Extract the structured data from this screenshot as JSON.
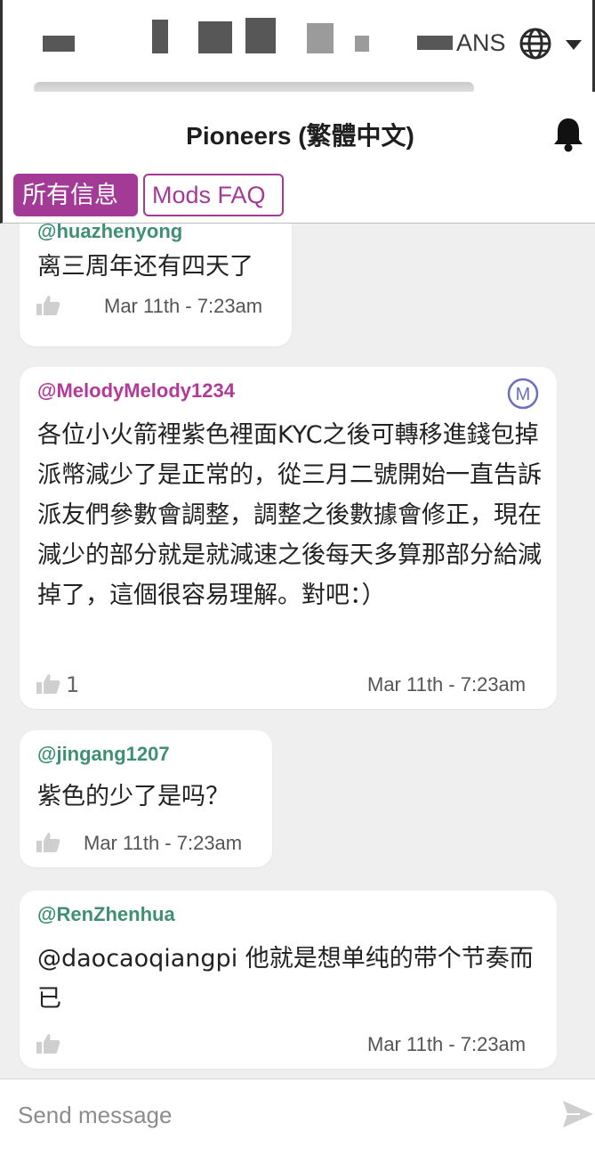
{
  "topbar": {
    "lang_label": "ANS"
  },
  "header": {
    "title": "Pioneers (繁體中文)"
  },
  "tabs": [
    {
      "label": "所有信息",
      "active": true
    },
    {
      "label": "Mods FAQ",
      "active": false
    }
  ],
  "messages": [
    {
      "author": "@huazhenyong",
      "text": "离三周年还有四天了",
      "likes": "",
      "time": "Mar 11th - 7:23am",
      "author_color": "#3f8f75"
    },
    {
      "author": "@MelodyMelody1234",
      "text": "各位小火箭裡紫色裡面KYC之後可轉移進錢包掉派幣減少了是正常的，從三月二號開始一直告訴派友們參數會調整，調整之後數據會修正，現在減少的部分就是就減速之後每天多算那部分給減掉了，這個很容易理解。對吧：）",
      "likes": "1",
      "time": "Mar 11th - 7:23am",
      "author_color": "#b43a9a",
      "moderator_badge": "M"
    },
    {
      "author": "@jingang1207",
      "text": "紫色的少了是吗？",
      "likes": "",
      "time": "Mar 11th - 7:23am",
      "author_color": "#3f8f75"
    },
    {
      "author": "@RenZhenhua",
      "text": "@daocaoqiangpi 他就是想单纯的带个节奏而已",
      "likes": "",
      "time": "Mar 11th - 7:23am",
      "author_color": "#3f8f75"
    }
  ],
  "composer": {
    "placeholder": "Send message"
  },
  "colors": {
    "accent": "#a33a96",
    "background": "#efefef"
  },
  "icons": [
    "globe-icon",
    "chevron-down-icon",
    "bell-icon",
    "thumbs-up-icon",
    "moderator-icon",
    "send-icon"
  ]
}
